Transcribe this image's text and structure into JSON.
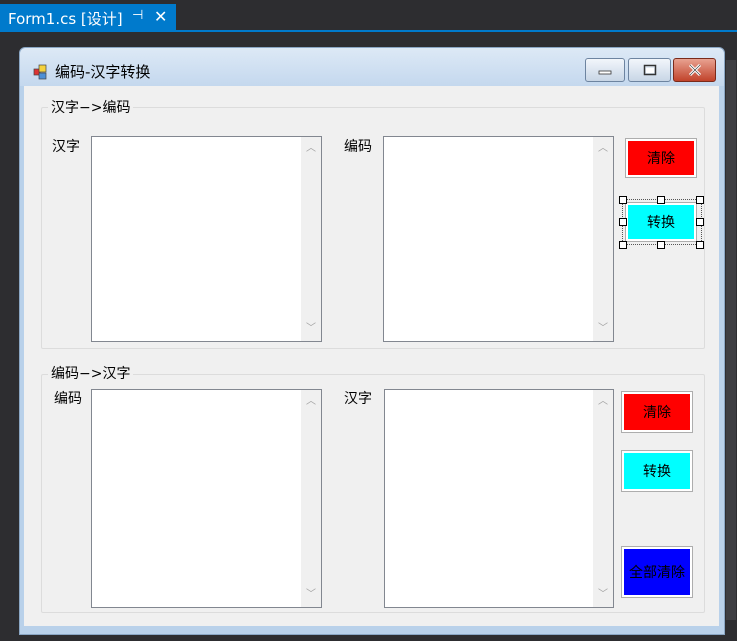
{
  "ide": {
    "tab_title": "Form1.cs [设计]",
    "pin_glyph": "⊣",
    "close_glyph": "✕"
  },
  "form": {
    "title": "编码-汉字转换",
    "min_glyph": "▬",
    "max_glyph": "▢",
    "close_glyph": "✕"
  },
  "group1": {
    "title": "汉字−>编码",
    "left_label": "汉字",
    "right_label": "编码",
    "clear_label": "清除",
    "convert_label": "转换"
  },
  "group2": {
    "title": "编码−>汉字",
    "left_label": "编码",
    "right_label": "汉字",
    "clear_label": "清除",
    "convert_label": "转换",
    "clear_all_label": "全部清除"
  },
  "colors": {
    "ide_tab": "#007acc",
    "clear_button": "#ff0000",
    "convert_button": "#00ffff",
    "clear_all_button": "#0000ff"
  },
  "icons": {
    "scroll_up": "chevron-up-icon",
    "scroll_down": "chevron-down-icon"
  }
}
